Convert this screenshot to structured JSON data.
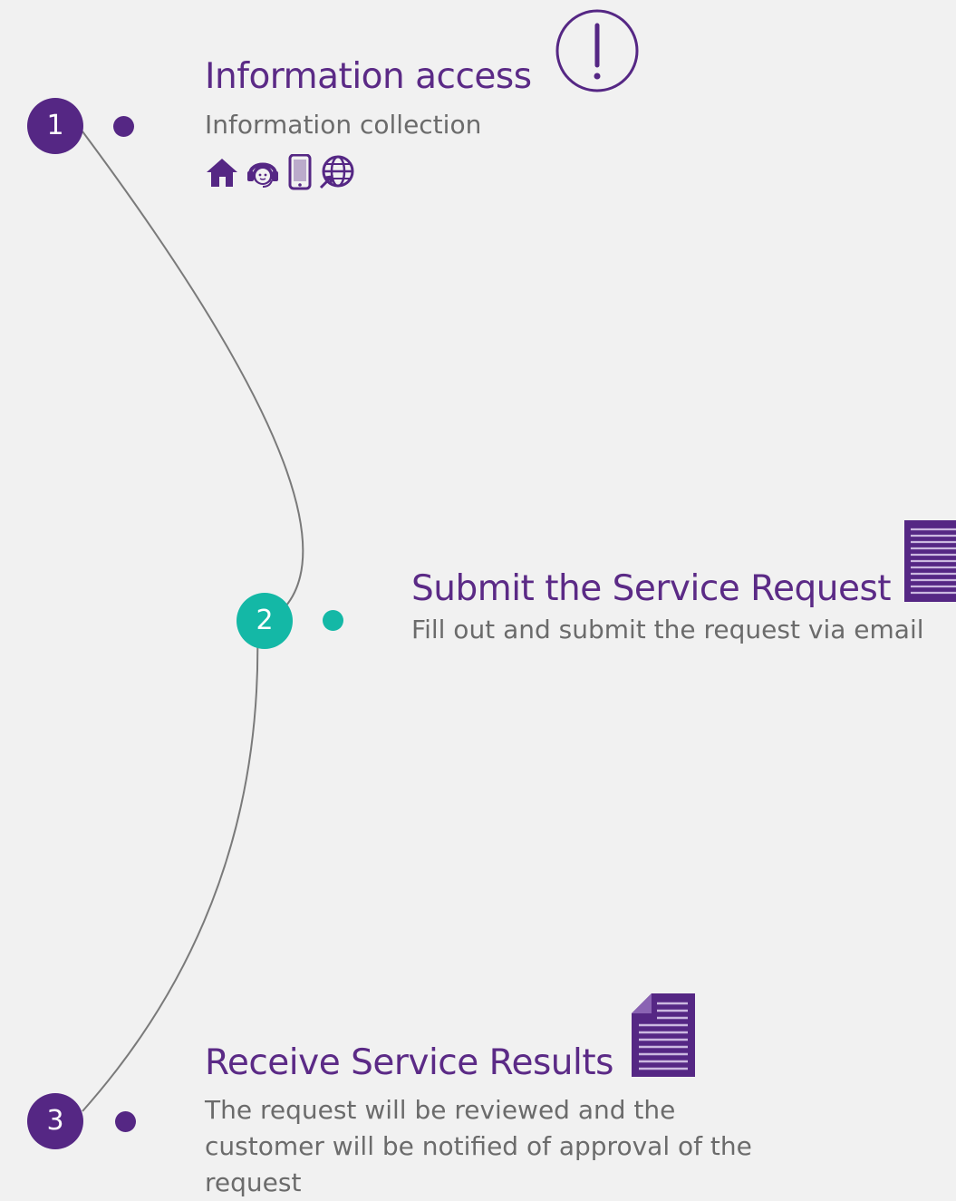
{
  "colors": {
    "purple": "#552784",
    "teal": "#14b8a6",
    "title": "#5b2a86",
    "text": "#6b6b6b",
    "line": "#7a7a7a",
    "background": "#f1f1f1"
  },
  "steps": [
    {
      "number": "1",
      "title": "Information access",
      "description": "Information collection",
      "title_icon": "exclamation-circle-icon",
      "channel_icons": [
        "home-icon",
        "customer-service-headset-icon",
        "mobile-phone-icon",
        "globe-website-icon"
      ]
    },
    {
      "number": "2",
      "title": "Submit the Service Request",
      "description": "Fill out and submit the request via email",
      "title_icon": "form-document-icon"
    },
    {
      "number": "3",
      "title": "Receive Service Results",
      "description": "The request will be reviewed and the customer will be notified of approval of the request",
      "title_icon": "document-icon"
    }
  ]
}
